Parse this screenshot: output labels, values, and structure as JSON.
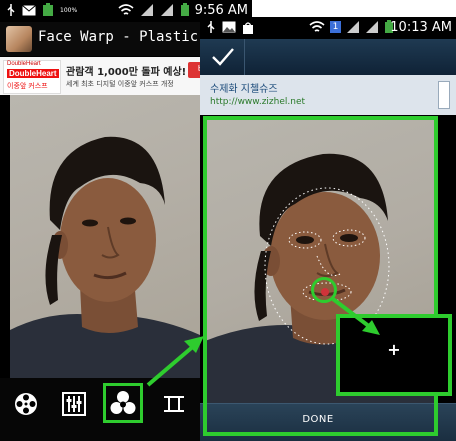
{
  "left_screen": {
    "status_bar": {
      "time": "9:56 AM",
      "battery_label": "100%",
      "icons": [
        "usb-icon",
        "mail-icon",
        "battery-full-icon",
        "wifi-icon",
        "signal-icon",
        "signal-icon",
        "battery-icon"
      ]
    },
    "app_title": "Face Warp - Plastic Surgery",
    "ad": {
      "brand_line1": "DoubleHeart",
      "brand_line2": "DoubleHeart",
      "brand_line3": "이중앞 커스프",
      "headline": "관람객 1,000만 돌파 예상!",
      "subline": "세계 최초 디지털 이중앞 커스프 개정",
      "button_label": "바로"
    },
    "toolbar": {
      "items": [
        {
          "icon": "film-reel-icon",
          "selected": false
        },
        {
          "icon": "sliders-icon",
          "selected": false
        },
        {
          "icon": "warp-blob-icon",
          "selected": true
        },
        {
          "icon": "crop-frame-icon",
          "selected": false
        }
      ]
    }
  },
  "right_screen": {
    "status_bar": {
      "time": "10:13 AM",
      "badge_count": "1",
      "icons": [
        "usb-icon",
        "image-icon",
        "bag-icon",
        "wifi-icon",
        "notification-badge-icon",
        "signal-icon",
        "signal-icon",
        "battery-icon"
      ]
    },
    "action_bar": {
      "confirm_icon": "checkmark-icon"
    },
    "ad": {
      "headline": "수제화 지첼슈즈",
      "url": "http://www.zizhel.net"
    },
    "zoom_overlay": {
      "crosshair": "+"
    },
    "done_label": "DONE"
  },
  "colors": {
    "highlight": "#2ecc2e",
    "action_bar": "#1f3a52",
    "warp_mesh": "#ffffff"
  }
}
